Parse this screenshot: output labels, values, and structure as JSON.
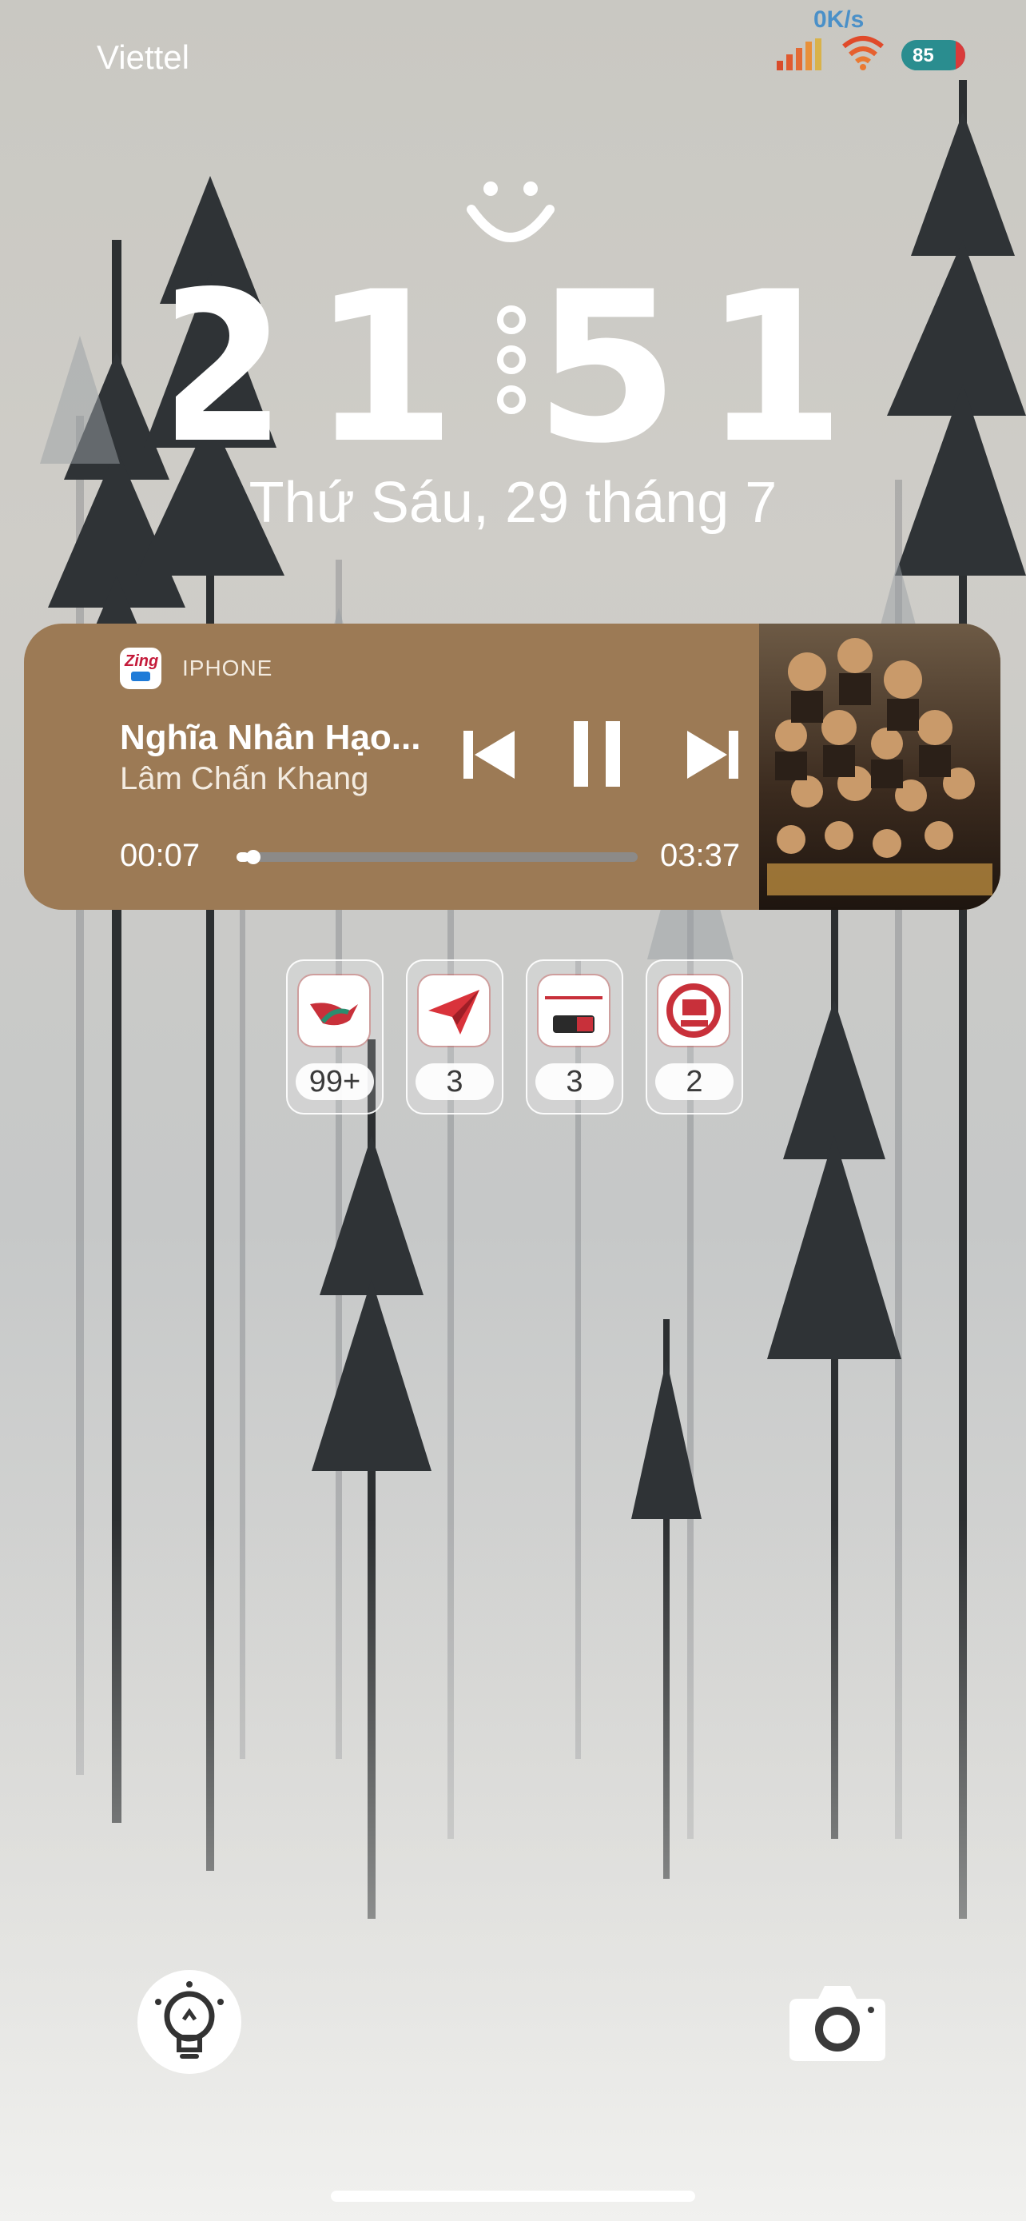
{
  "status_bar": {
    "carrier": "Viettel",
    "network_speed": "0K/s",
    "battery_level": "85",
    "battery_fraction": 0.85
  },
  "lock_screen": {
    "time_hours": "21",
    "time_minutes": "51",
    "date": "Thứ Sáu, 29 tháng 7"
  },
  "now_playing": {
    "app_icon": "zing-mp3-icon",
    "source": "IPHONE",
    "title": "Nghĩa Nhân Hạo...",
    "artist": "Lâm Chấn Khang",
    "elapsed": "00:07",
    "duration": "03:37",
    "progress": 0.032,
    "background_color": "#9c7a55"
  },
  "app_shortcuts": [
    {
      "icon": "swallow-bird-app-icon",
      "count": "99+"
    },
    {
      "icon": "paper-plane-app-icon",
      "count": "3"
    },
    {
      "icon": "bao-moi-24h-app-icon",
      "count": "3"
    },
    {
      "icon": "24h-tin-tuc-app-icon",
      "count": "2"
    }
  ],
  "bottom_controls": {
    "left": "flashlight-icon",
    "right": "camera-icon"
  }
}
